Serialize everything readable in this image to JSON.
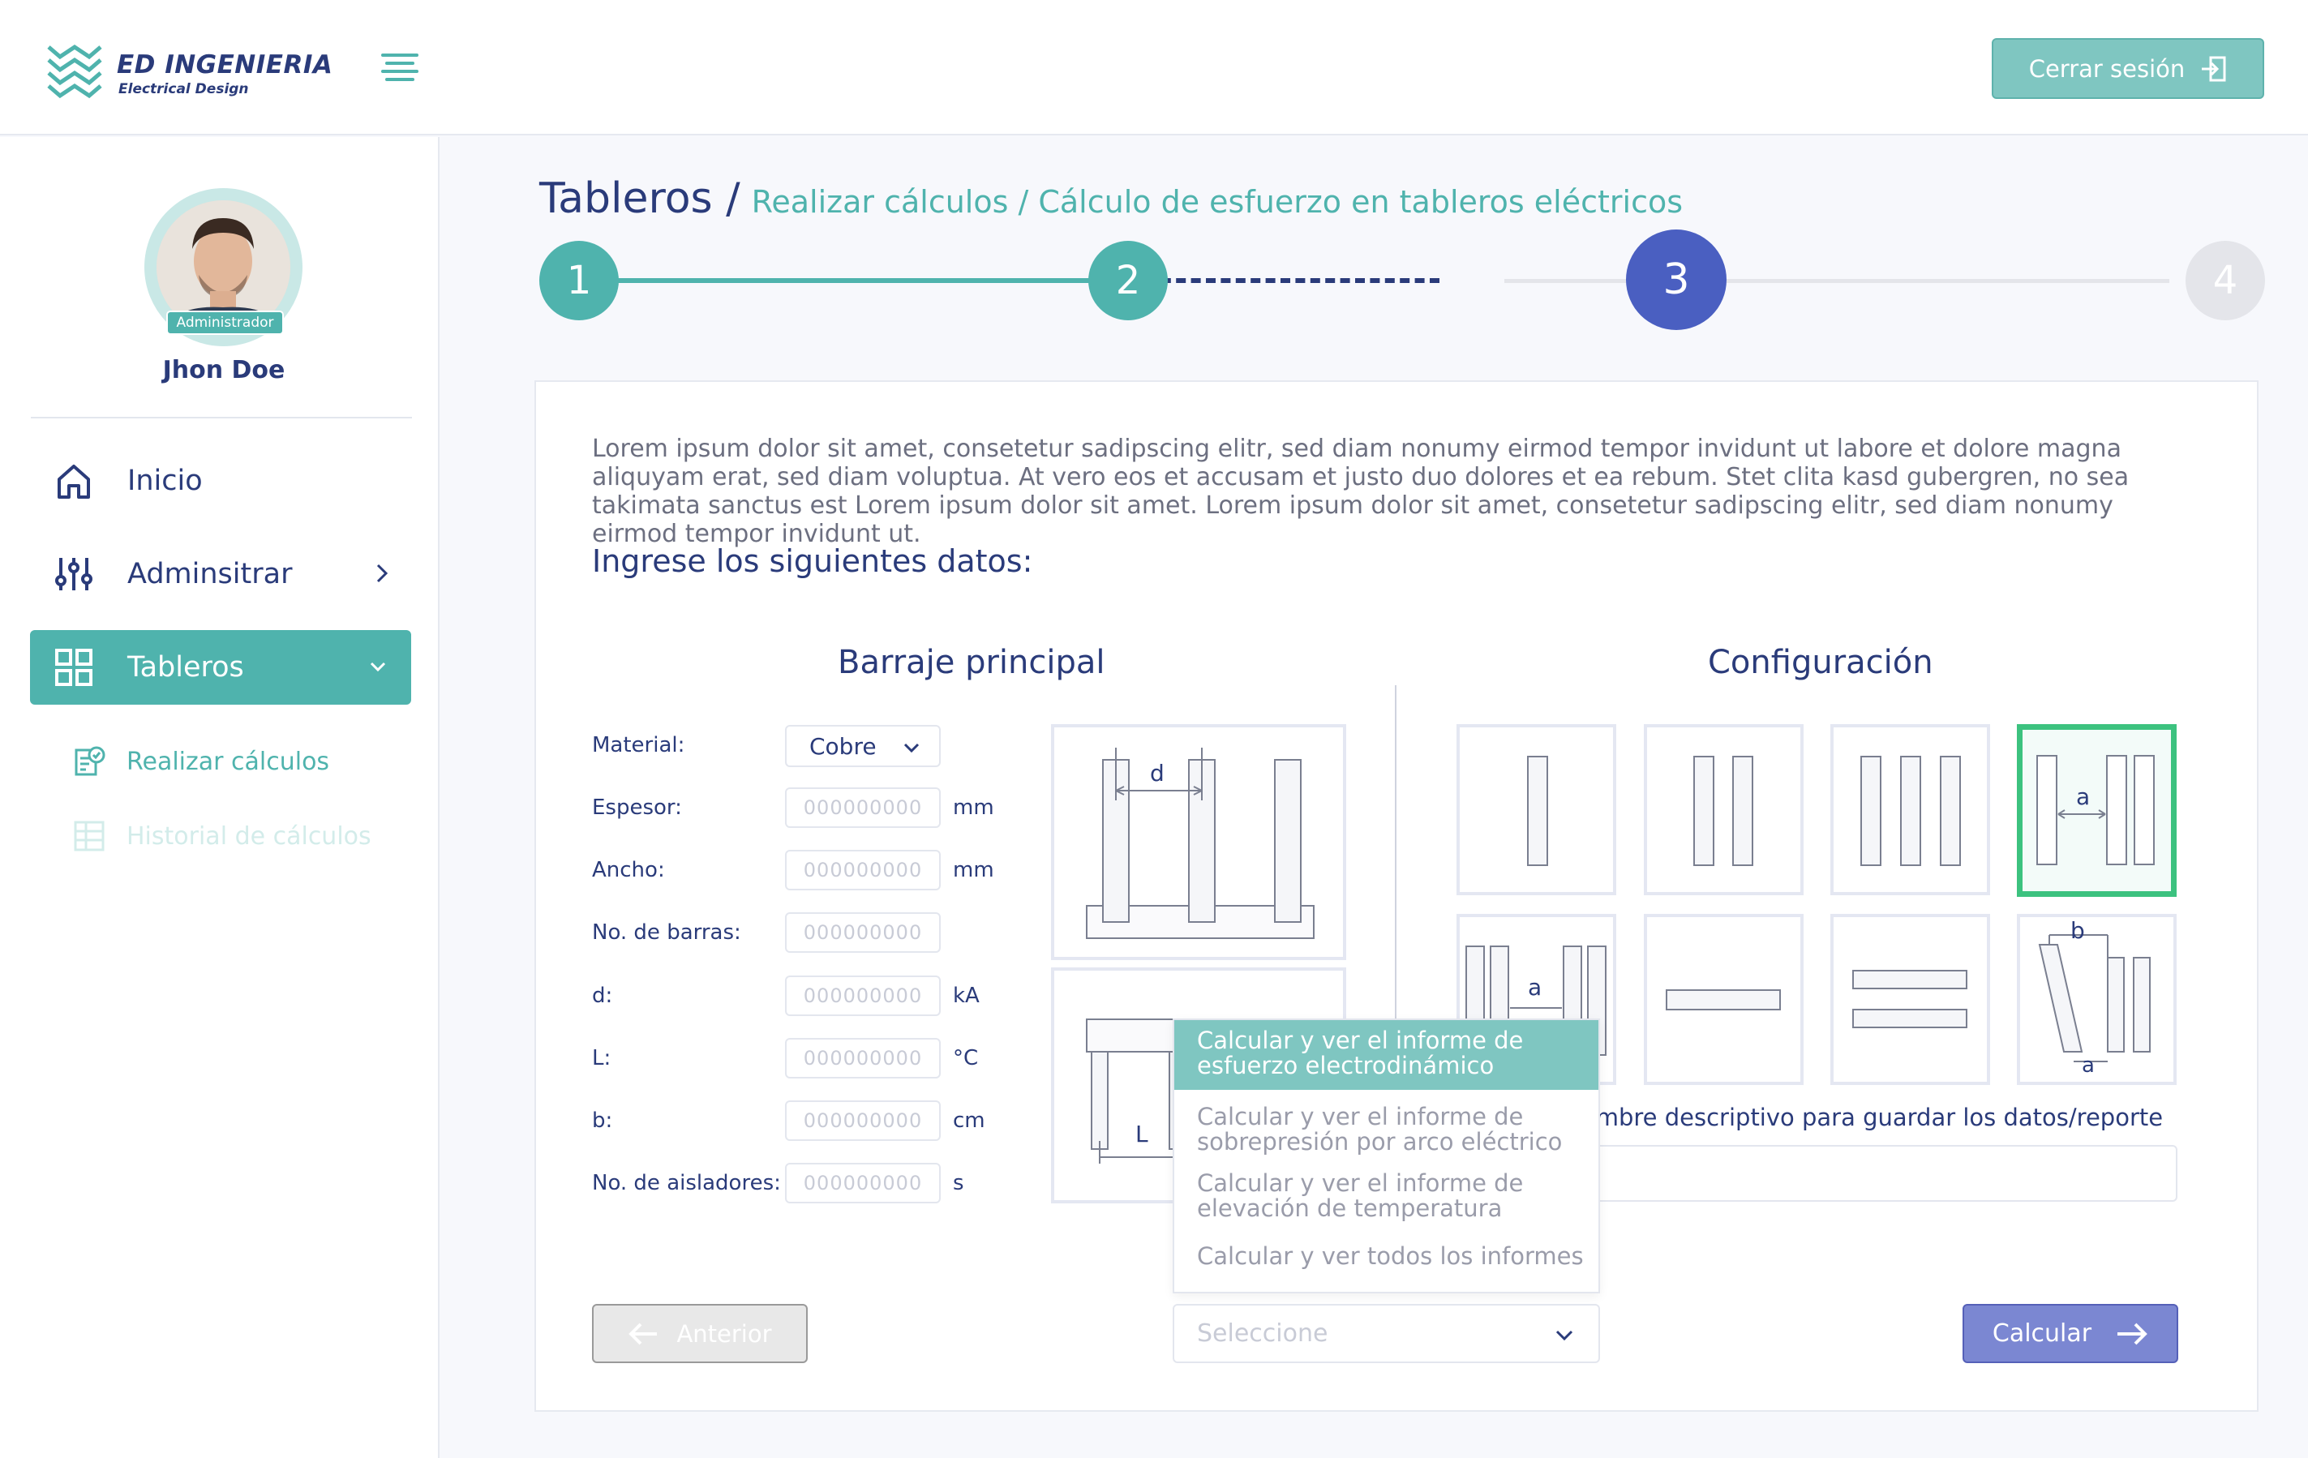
{
  "header": {
    "logo_title": "ED INGENIERIA",
    "logo_subtitle": "Electrical Design",
    "logout_label": "Cerrar sesión"
  },
  "sidebar": {
    "role_badge": "Administrador",
    "username": "Jhon Doe",
    "nav": [
      {
        "label": "Inicio",
        "icon": "home-icon"
      },
      {
        "label": "Adminsitrar",
        "icon": "sliders-icon"
      },
      {
        "label": "Tableros",
        "icon": "grid-icon",
        "active": true
      }
    ],
    "sub_items": [
      {
        "label": "Realizar cálculos",
        "icon": "clipboard-check-icon"
      },
      {
        "label": "Historial de cálculos",
        "icon": "table-icon",
        "muted": true
      }
    ]
  },
  "breadcrumb": {
    "main": "Tableros /",
    "rest": "Realizar cálculos / Cálculo de esfuerzo en tableros eléctricos"
  },
  "stepper": {
    "steps": [
      "1",
      "2",
      "3",
      "4"
    ],
    "current": 3
  },
  "content": {
    "intro": "Lorem ipsum dolor sit amet, consetetur sadipscing elitr, sed diam nonumy eirmod tempor invidunt ut labore et dolore magna aliquyam erat, sed diam voluptua. At vero eos et accusam et justo duo dolores et ea rebum. Stet clita kasd gubergren, no sea takimata sanctus est Lorem ipsum dolor sit amet. Lorem ipsum dolor sit amet, consetetur sadipscing elitr, sed diam nonumy eirmod tempor invidunt ut.",
    "subtitle": "Ingrese los siguientes datos:",
    "barraje_title": "Barraje principal",
    "config_title": "Configuración"
  },
  "form": {
    "material_label": "Material:",
    "material_value": "Cobre",
    "fields": [
      {
        "label": "Espesor:",
        "placeholder": "000000000",
        "unit": "mm"
      },
      {
        "label": "Ancho:",
        "placeholder": "000000000",
        "unit": "mm"
      },
      {
        "label": "No. de barras:",
        "placeholder": "000000000",
        "unit": ""
      },
      {
        "label": "d:",
        "placeholder": "000000000",
        "unit": "kA"
      },
      {
        "label": "L:",
        "placeholder": "000000000",
        "unit": "°C"
      },
      {
        "label": "b:",
        "placeholder": "000000000",
        "unit": "cm"
      },
      {
        "label": "No. de aisladores:",
        "placeholder": "000000000",
        "unit": "s"
      }
    ]
  },
  "diagram_labels": {
    "d": "d",
    "L": "L",
    "a": "a",
    "b": "b"
  },
  "report": {
    "label": "ombre descriptivo para guardar los datos/reporte"
  },
  "dropdown": {
    "options": [
      {
        "line1": "Calcular y ver el informe de",
        "line2": "esfuerzo electrodinámico",
        "active": true
      },
      {
        "line1": "Calcular y ver el informe de",
        "line2": "sobrepresión por arco eléctrico"
      },
      {
        "line1": "Calcular y ver el informe de",
        "line2": "elevación de temperatura"
      },
      {
        "line1": "Calcular y ver todos los informes",
        "line2": ""
      }
    ],
    "placeholder": "Seleccione"
  },
  "buttons": {
    "prev": "Anterior",
    "calc": "Calcular"
  },
  "colors": {
    "teal": "#4fb3ad",
    "navy": "#2a3b7a",
    "indigo": "#4a5fc1",
    "selected_green": "#3cc27f"
  }
}
